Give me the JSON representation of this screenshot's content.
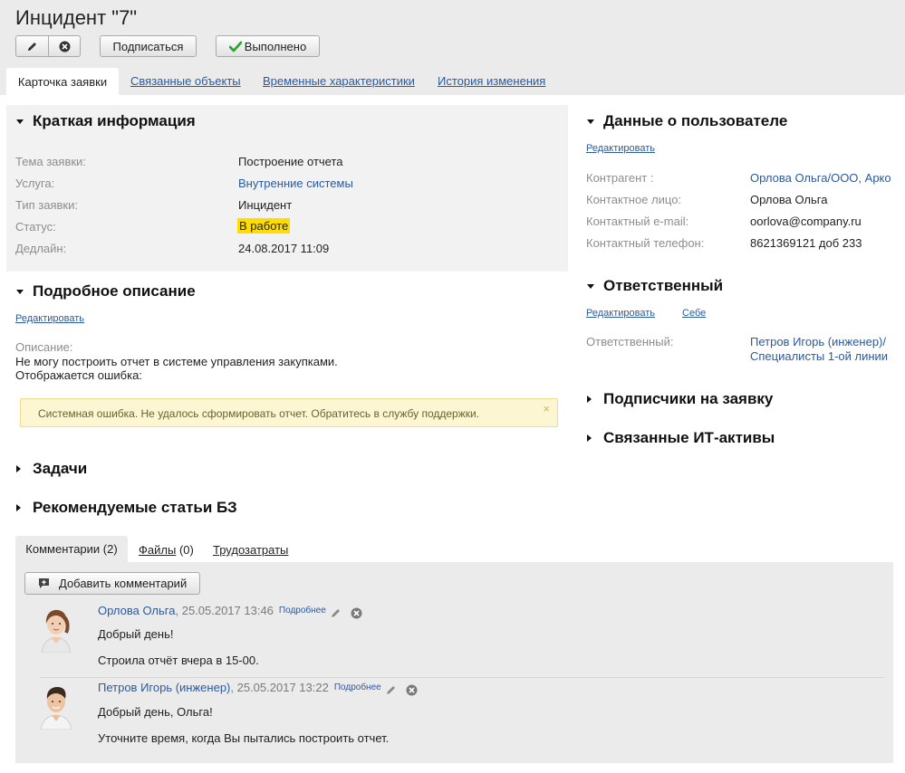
{
  "header": {
    "title": "Инцидент \"7\"",
    "buttons": {
      "subscribe": "Подписаться",
      "done": "Выполнено"
    }
  },
  "tabs": [
    "Карточка заявки",
    "Связанные объекты",
    "Временные характеристики",
    "История изменения"
  ],
  "brief": {
    "title": "Краткая информация",
    "rows": [
      {
        "label": "Тема заявки:",
        "value": "Построение отчета"
      },
      {
        "label": "Услуга:",
        "value": "Внутренние системы"
      },
      {
        "label": "Тип заявки:",
        "value": "Инцидент"
      },
      {
        "label": "Статус:",
        "value": "В работе"
      },
      {
        "label": "Дедлайн:",
        "value": "24.08.2017 11:09"
      }
    ]
  },
  "description": {
    "title": "Подробное описание",
    "edit": "Редактировать",
    "label": "Описание:",
    "lines": [
      "Не могу построить отчет в системе управления закупками.",
      "Отображается ошибка:"
    ],
    "error": "Системная ошибка. Не удалось сформировать отчет. Обратитесь в службу поддержки.",
    "error_close": "×"
  },
  "tasks_title": "Задачи",
  "kb_title": "Рекомендуемые статьи БЗ",
  "user": {
    "title": "Данные о пользователе",
    "edit": "Редактировать",
    "rows": [
      {
        "label": "Контрагент :",
        "value": "Орлова Ольга/ООО, Арко"
      },
      {
        "label": "Контактное лицо:",
        "value": "Орлова Ольга"
      },
      {
        "label": "Контактный e-mail:",
        "value": "oorlova@company.ru"
      },
      {
        "label": "Контактный телефон:",
        "value": "8621369121 доб 233"
      }
    ]
  },
  "responsible": {
    "title": "Ответственный",
    "edit": "Редактировать",
    "self": "Себе",
    "label": "Ответственный:",
    "value_line1": "Петров Игорь (инженер)/",
    "value_line2": "Специалисты 1-ой линии"
  },
  "subscribers_title": "Подписчики на заявку",
  "assets_title": "Связанные ИТ-активы",
  "comment_tabs": {
    "comments": "Комментарии (2)",
    "files": "Файлы",
    "files_count": "(0)",
    "labor": "Трудозатраты"
  },
  "add_comment": "Добавить комментарий",
  "comments": [
    {
      "author": "Орлова Ольга",
      "date": ", 25.05.2017 13:46",
      "more": "Подробнее",
      "lines": [
        "Добрый день!",
        "Строила отчёт вчера в 15-00."
      ]
    },
    {
      "author": "Петров Игорь (инженер)",
      "date": ", 25.05.2017 13:22",
      "more": "Подробнее",
      "lines": [
        "Добрый день, Ольга!",
        "Уточните время, когда Вы пытались построить отчет."
      ]
    }
  ],
  "colors": {
    "link": "#2a5aa0",
    "status_badge": "#ffdd00",
    "error_bg": "#fcf6d3",
    "done_check": "#2ea52e"
  }
}
